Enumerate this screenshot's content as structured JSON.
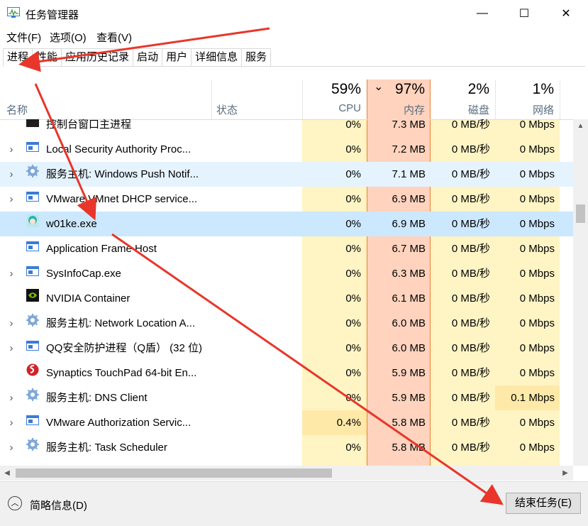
{
  "window": {
    "title": "任务管理器",
    "minimize": "—",
    "maximize": "☐",
    "close": "✕"
  },
  "menu": [
    "文件(F)",
    "选项(O)",
    "查看(V)"
  ],
  "tabs": [
    "进程",
    "性能",
    "应用历史记录",
    "启动",
    "用户",
    "详细信息",
    "服务"
  ],
  "columns": {
    "name": "名称",
    "status": "状态",
    "cpu": {
      "pct": "59%",
      "label": "CPU"
    },
    "memory": {
      "pct": "97%",
      "label": "内存",
      "sort_glyph": "⌄"
    },
    "disk": {
      "pct": "2%",
      "label": "磁盘"
    },
    "network": {
      "pct": "1%",
      "label": "网络"
    }
  },
  "rows": [
    {
      "name": "控制台窗口主进程",
      "expand": "",
      "icon": "console-icon",
      "cpu": "0%",
      "mem": "7.3 MB",
      "disk": "0 MB/秒",
      "net": "0 Mbps"
    },
    {
      "name": "Local Security Authority Proc...",
      "expand": "›",
      "icon": "app-window-icon",
      "cpu": "0%",
      "mem": "7.2 MB",
      "disk": "0 MB/秒",
      "net": "0 Mbps"
    },
    {
      "name": "服务主机: Windows Push Notif...",
      "expand": "›",
      "icon": "gear-icon",
      "cpu": "0%",
      "mem": "7.1 MB",
      "disk": "0 MB/秒",
      "net": "0 Mbps"
    },
    {
      "name": "VMware VMnet DHCP service...",
      "expand": "›",
      "icon": "app-window-icon",
      "cpu": "0%",
      "mem": "6.9 MB",
      "disk": "0 MB/秒",
      "net": "0 Mbps"
    },
    {
      "name": "w01ke.exe",
      "expand": "",
      "icon": "anime-avatar-icon",
      "cpu": "0%",
      "mem": "6.9 MB",
      "disk": "0 MB/秒",
      "net": "0 Mbps"
    },
    {
      "name": "Application Frame Host",
      "expand": "",
      "icon": "app-window-icon",
      "cpu": "0%",
      "mem": "6.7 MB",
      "disk": "0 MB/秒",
      "net": "0 Mbps"
    },
    {
      "name": "SysInfoCap.exe",
      "expand": "›",
      "icon": "app-window-icon",
      "cpu": "0%",
      "mem": "6.3 MB",
      "disk": "0 MB/秒",
      "net": "0 Mbps"
    },
    {
      "name": "NVIDIA Container",
      "expand": "",
      "icon": "nvidia-icon",
      "cpu": "0%",
      "mem": "6.1 MB",
      "disk": "0 MB/秒",
      "net": "0 Mbps"
    },
    {
      "name": "服务主机: Network Location A...",
      "expand": "›",
      "icon": "gear-icon",
      "cpu": "0%",
      "mem": "6.0 MB",
      "disk": "0 MB/秒",
      "net": "0 Mbps"
    },
    {
      "name": "QQ安全防护进程（Q盾） (32 位)",
      "expand": "›",
      "icon": "app-window-icon",
      "cpu": "0%",
      "mem": "6.0 MB",
      "disk": "0 MB/秒",
      "net": "0 Mbps"
    },
    {
      "name": "Synaptics TouchPad 64-bit En...",
      "expand": "",
      "icon": "synaptics-icon",
      "cpu": "0%",
      "mem": "5.9 MB",
      "disk": "0 MB/秒",
      "net": "0 Mbps"
    },
    {
      "name": "服务主机: DNS Client",
      "expand": "›",
      "icon": "gear-icon",
      "cpu": "0%",
      "mem": "5.9 MB",
      "disk": "0 MB/秒",
      "net": "0.1 Mbps"
    },
    {
      "name": "VMware Authorization Servic...",
      "expand": "›",
      "icon": "app-window-icon",
      "cpu": "0.4%",
      "mem": "5.8 MB",
      "disk": "0 MB/秒",
      "net": "0 Mbps"
    },
    {
      "name": "服务主机: Task Scheduler",
      "expand": "›",
      "icon": "gear-icon",
      "cpu": "0%",
      "mem": "5.8 MB",
      "disk": "0 MB/秒",
      "net": "0 Mbps"
    }
  ],
  "footer": {
    "fewer_details": "简略信息(D)",
    "end_task": "结束任务(E)"
  },
  "colors": {
    "cpu_bg": "#fff4c4",
    "cpu_bg_high": "#ffe9a8",
    "mem_bg": "#ffd3be",
    "selected_row": "#cce8ff",
    "hover_row": "#e5f3ff",
    "annotation_arrow": "#e8362b"
  }
}
